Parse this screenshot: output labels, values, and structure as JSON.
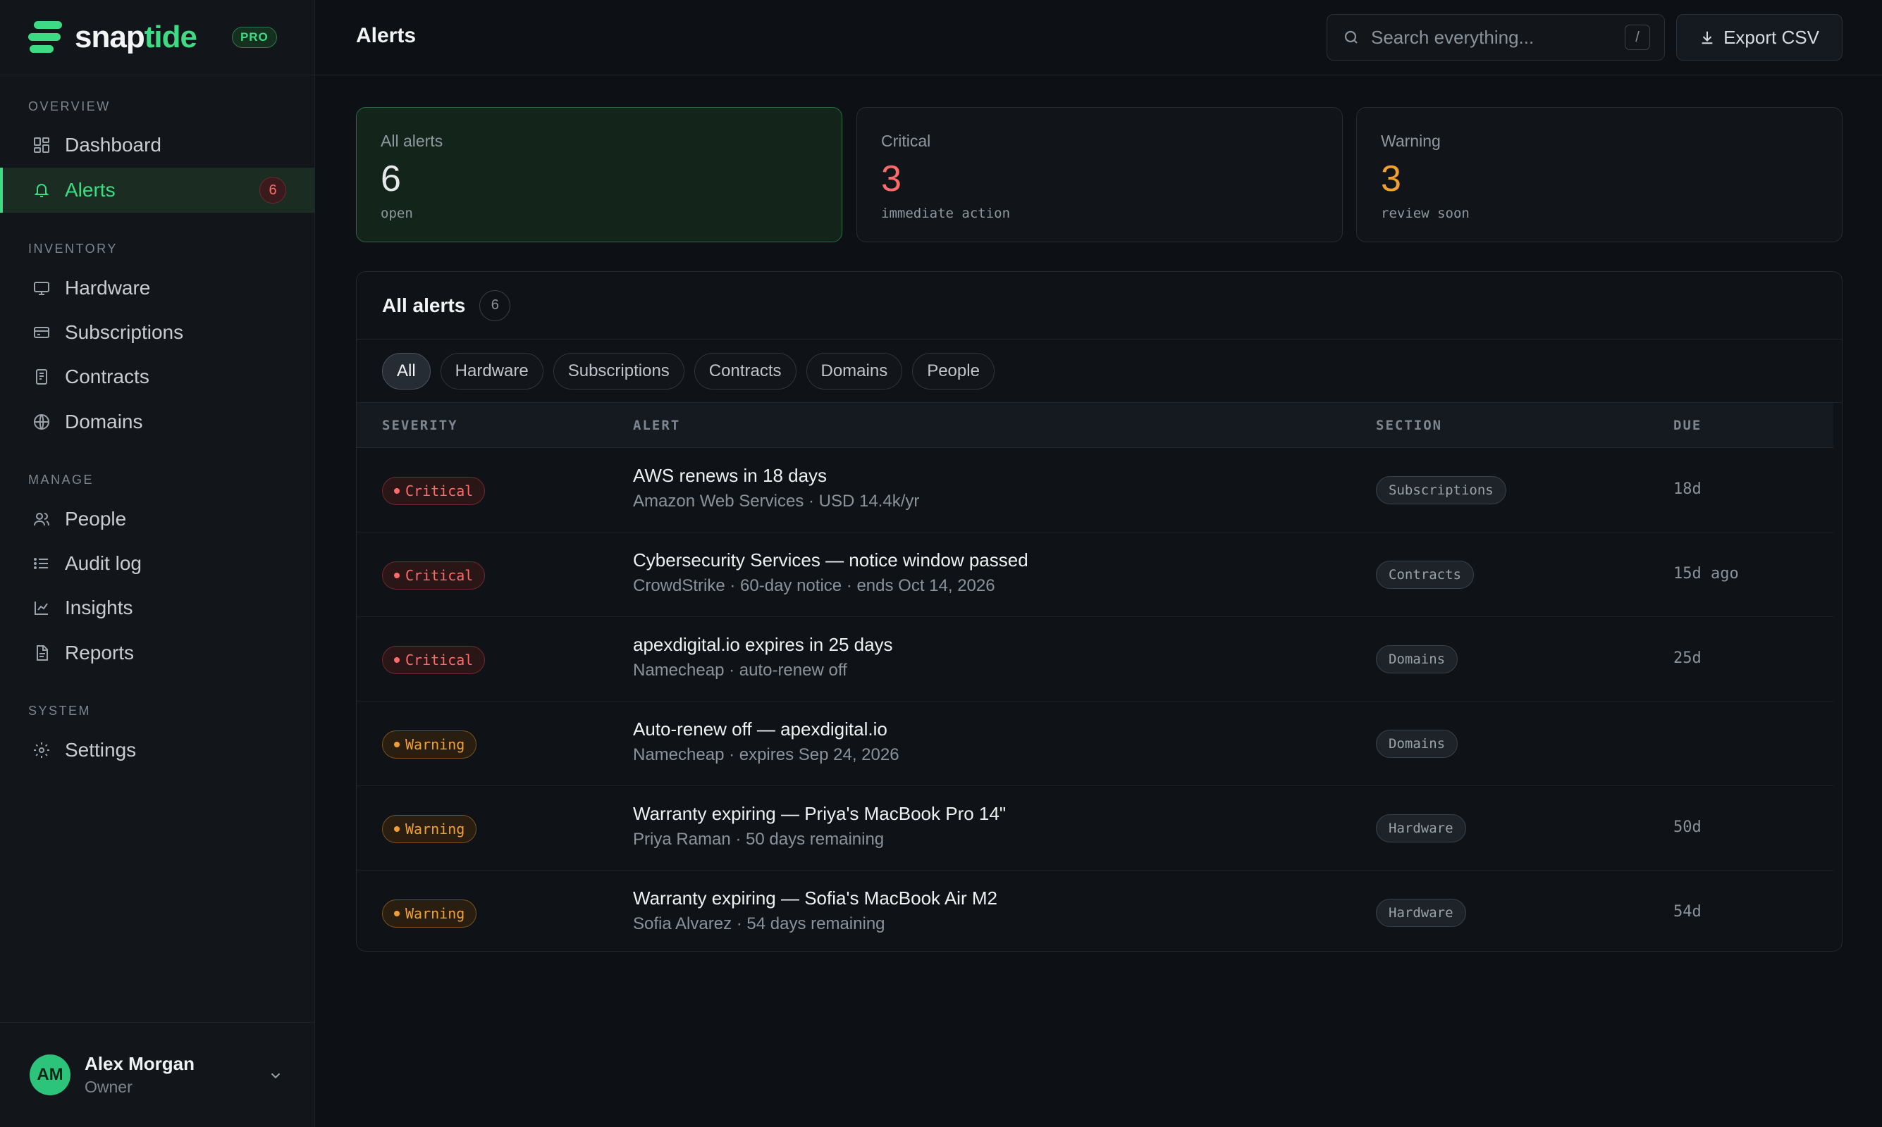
{
  "brand": {
    "name_main": "snap",
    "name_accent": "tide",
    "badge": "PRO"
  },
  "sidebar": {
    "sections": [
      {
        "label": "OVERVIEW"
      },
      {
        "label": "INVENTORY"
      },
      {
        "label": "MANAGE"
      },
      {
        "label": "SYSTEM"
      }
    ],
    "items": [
      {
        "label": "Dashboard",
        "icon": "dashboard-icon"
      },
      {
        "label": "Alerts",
        "icon": "bell-icon",
        "badge": "6",
        "active": true
      },
      {
        "label": "Hardware",
        "icon": "monitor-icon"
      },
      {
        "label": "Subscriptions",
        "icon": "card-icon"
      },
      {
        "label": "Contracts",
        "icon": "contract-icon"
      },
      {
        "label": "Domains",
        "icon": "globe-icon"
      },
      {
        "label": "People",
        "icon": "people-icon"
      },
      {
        "label": "Audit log",
        "icon": "list-icon"
      },
      {
        "label": "Insights",
        "icon": "chart-icon"
      },
      {
        "label": "Reports",
        "icon": "report-icon"
      },
      {
        "label": "Settings",
        "icon": "gear-icon"
      }
    ]
  },
  "user": {
    "initials": "AM",
    "name": "Alex Morgan",
    "role": "Owner"
  },
  "header": {
    "title": "Alerts",
    "search_placeholder": "Search everything...",
    "search_shortcut": "/",
    "export_label": "Export CSV"
  },
  "stats": [
    {
      "label": "All alerts",
      "value": "6",
      "sub": "open",
      "color": "#e6e8eb"
    },
    {
      "label": "Critical",
      "value": "3",
      "sub": "immediate action",
      "color": "#ff6b6b"
    },
    {
      "label": "Warning",
      "value": "3",
      "sub": "review soon",
      "color": "#f0a030"
    }
  ],
  "table": {
    "title": "All alerts",
    "count": "6",
    "filters": [
      "All",
      "Hardware",
      "Subscriptions",
      "Contracts",
      "Domains",
      "People"
    ],
    "active_filter": "All",
    "columns": {
      "severity": "SEVERITY",
      "alert": "ALERT",
      "section": "SECTION",
      "due": "DUE"
    },
    "rows": [
      {
        "severity": "Critical",
        "title": "AWS renews in 18 days",
        "sub": "Amazon Web Services · USD 14.4k/yr",
        "section": "Subscriptions",
        "due": "18d"
      },
      {
        "severity": "Critical",
        "title": "Cybersecurity Services — notice window passed",
        "sub": "CrowdStrike · 60-day notice · ends Oct 14, 2026",
        "section": "Contracts",
        "due": "15d ago"
      },
      {
        "severity": "Critical",
        "title": "apexdigital.io expires in 25 days",
        "sub": "Namecheap · auto-renew off",
        "section": "Domains",
        "due": "25d"
      },
      {
        "severity": "Warning",
        "title": "Auto-renew off — apexdigital.io",
        "sub": "Namecheap · expires Sep 24, 2026",
        "section": "Domains",
        "due": ""
      },
      {
        "severity": "Warning",
        "title": "Warranty expiring — Priya's MacBook Pro 14\"",
        "sub": "Priya Raman · 50 days remaining",
        "section": "Hardware",
        "due": "50d"
      },
      {
        "severity": "Warning",
        "title": "Warranty expiring — Sofia's MacBook Air M2",
        "sub": "Sofia Alvarez · 54 days remaining",
        "section": "Hardware",
        "due": "54d"
      }
    ]
  },
  "colors": {
    "accent": "#3ddc84",
    "critical": "#ff6b6b",
    "warning": "#f0a030",
    "background": "#0d1014"
  }
}
